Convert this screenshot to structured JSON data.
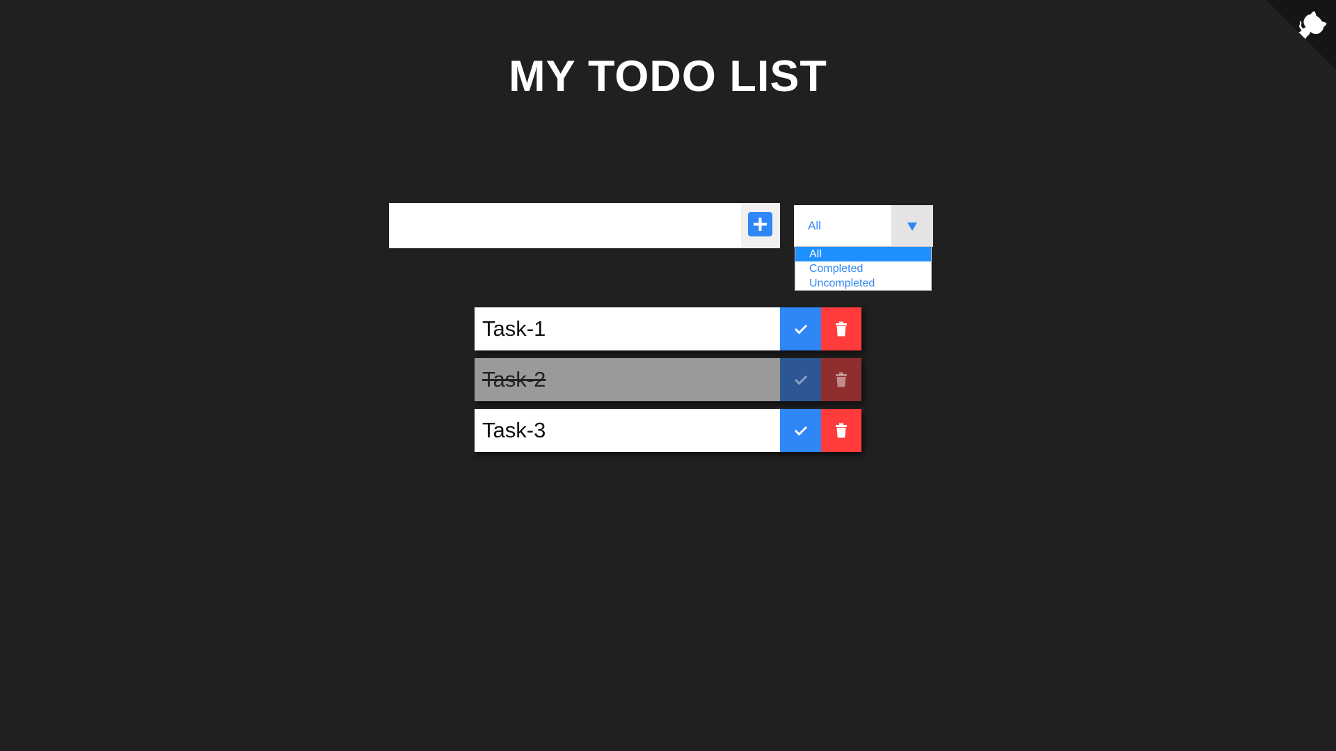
{
  "page": {
    "title": "MY TODO LIST"
  },
  "header": {
    "github_corner_icon": "github-octocat-icon"
  },
  "input": {
    "value": "",
    "placeholder": "",
    "add_icon": "plus-icon"
  },
  "filter": {
    "selected": "All",
    "arrow_icon": "triangle-down-icon",
    "options": [
      "All",
      "Completed",
      "Uncompleted"
    ],
    "highlighted_option": "All"
  },
  "todos": [
    {
      "text": "Task-1",
      "completed": false
    },
    {
      "text": "Task-2",
      "completed": true
    },
    {
      "text": "Task-3",
      "completed": false
    }
  ],
  "icons": {
    "complete": "check-icon",
    "delete": "trash-icon"
  },
  "colors": {
    "background": "#202020",
    "accent_blue": "#2f86f6",
    "delete_red": "#ff3b3b",
    "completed_gray": "#9a9a9a"
  }
}
